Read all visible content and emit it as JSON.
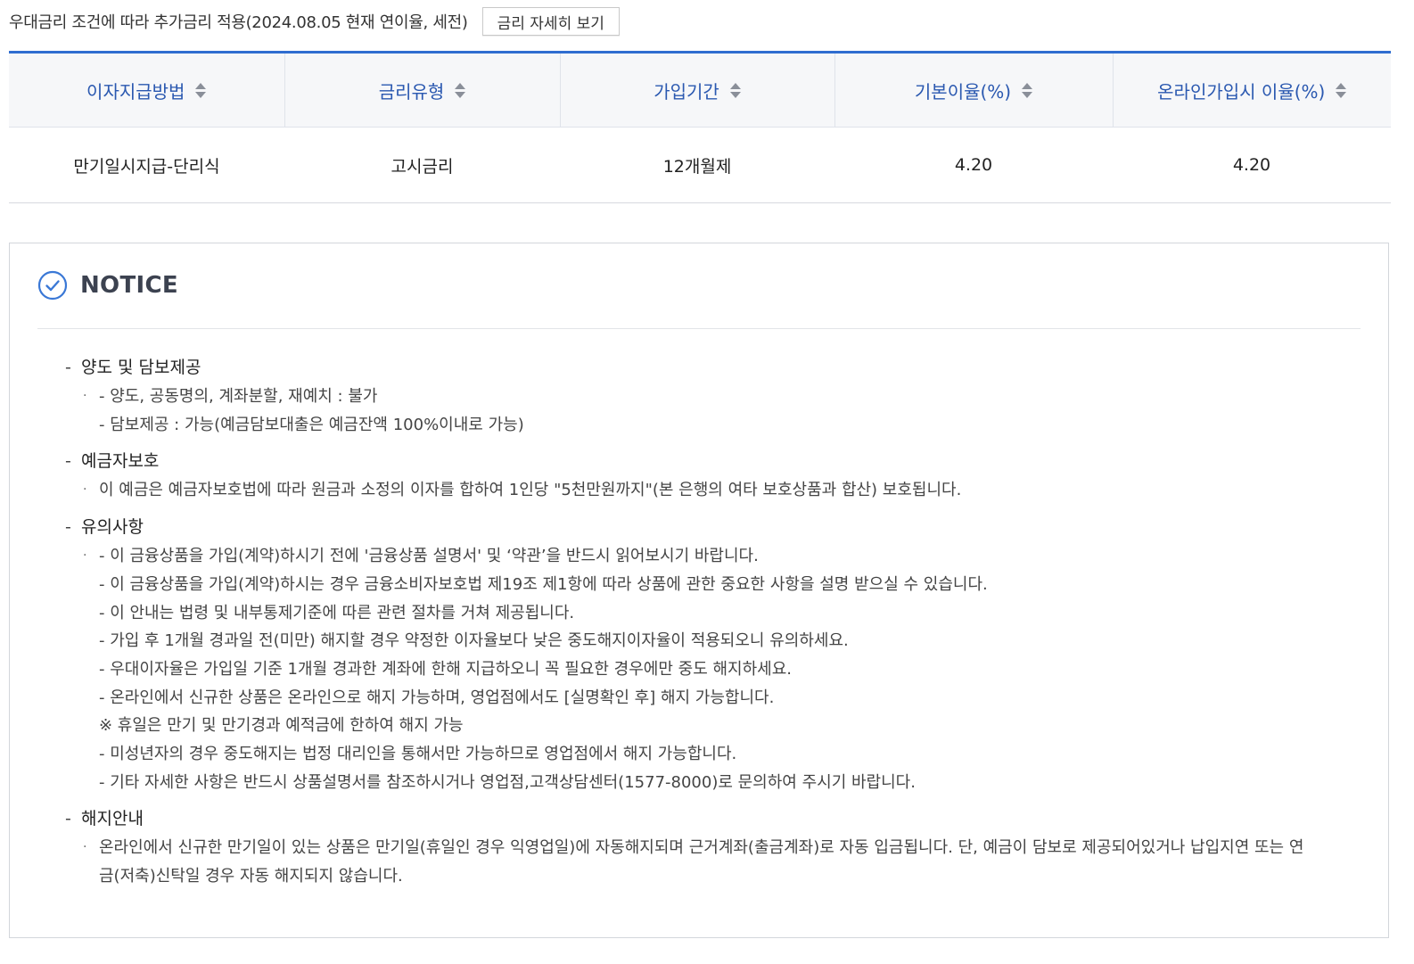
{
  "rate_note": {
    "text": "우대금리 조건에 따라 추가금리 적용(2024.08.05 현재 연이율, 세전)",
    "detail_button": "금리 자세히 보기"
  },
  "rate_table": {
    "headers": [
      "이자지급방법",
      "금리유형",
      "가입기간",
      "기본이율(%)",
      "온라인가입시 이율(%)"
    ],
    "rows": [
      [
        "만기일시지급-단리식",
        "고시금리",
        "12개월제",
        "4.20",
        "4.20"
      ]
    ],
    "accent_color": "#2f6dd0"
  },
  "notice": {
    "title": "NOTICE",
    "icon": "check-circle-icon",
    "sections": [
      {
        "title": "양도 및 담보제공",
        "lines": [
          "- 양도, 공동명의, 계좌분할, 재예치 : 불가",
          "- 담보제공 : 가능(예금담보대출은 예금잔액 100%이내로 가능)"
        ]
      },
      {
        "title": "예금자보호",
        "lines": [
          "이 예금은 예금자보호법에 따라 원금과 소정의 이자를 합하여 1인당 \"5천만원까지\"(본 은행의 여타 보호상품과 합산) 보호됩니다."
        ]
      },
      {
        "title": "유의사항",
        "lines": [
          "- 이 금융상품을 가입(계약)하시기 전에 '금융상품 설명서' 및 ‘약관’을 반드시 읽어보시기 바랍니다.",
          "- 이 금융상품을 가입(계약)하시는 경우 금융소비자보호법 제19조 제1항에 따라 상품에 관한 중요한 사항을 설명 받으실 수 있습니다.",
          "- 이 안내는 법령 및 내부통제기준에 따른 관련 절차를 거쳐 제공됩니다.",
          "- 가입 후 1개월 경과일 전(미만) 해지할 경우 약정한 이자율보다 낮은 중도해지이자율이 적용되오니 유의하세요.",
          "- 우대이자율은 가입일 기준 1개월 경과한 계좌에 한해 지급하오니 꼭 필요한 경우에만 중도 해지하세요.",
          "- 온라인에서 신규한 상품은 온라인으로 해지 가능하며, 영업점에서도 [실명확인 후] 해지 가능합니다.",
          "※ 휴일은 만기 및 만기경과 예적금에 한하여 해지 가능",
          "- 미성년자의 경우 중도해지는 법정 대리인을 통해서만 가능하므로 영업점에서 해지 가능합니다.",
          "- 기타 자세한 사항은 반드시 상품설명서를 참조하시거나 영업점,고객상담센터(1577-8000)로 문의하여 주시기 바랍니다."
        ]
      },
      {
        "title": "해지안내",
        "lines": [
          "온라인에서 신규한 만기일이 있는 상품은 만기일(휴일인 경우 익영업일)에 자동해지되며 근거계좌(출금계좌)로 자동 입금됩니다. 단, 예금이 담보로 제공되어있거나 납입지연 또는 연금(저축)신탁일 경우 자동 해지되지 않습니다."
        ]
      }
    ]
  }
}
